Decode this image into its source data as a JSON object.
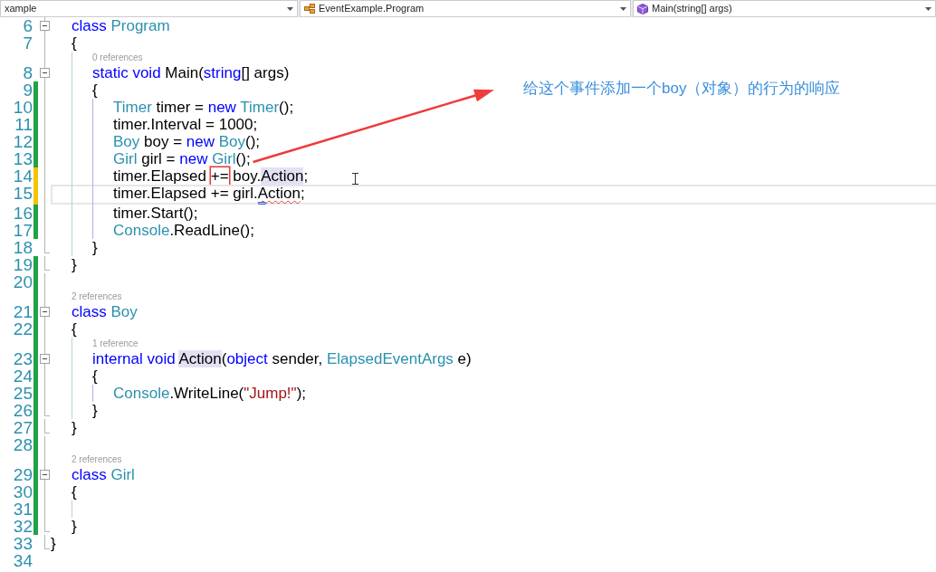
{
  "nav_bar": {
    "dropdowns": [
      {
        "label": "xample"
      },
      {
        "label": "EventExample.Program"
      },
      {
        "label": "Main(string[] args)"
      }
    ]
  },
  "code": [
    {
      "children": [
        {
          "number": "6",
          "expanded": true,
          "tokens": [
            {
              "text": "class",
              "kind": "keyword"
            },
            {
              "text": " Program",
              "kind": "type"
            }
          ]
        },
        {
          "number": "7",
          "tokens": [
            {
              "text": "{",
              "kind": "plain"
            }
          ],
          "children": [
            {
              "number": "8",
              "expanded": true,
              "lens": "0 references",
              "tokens": [
                {
                  "text": "static",
                  "kind": "keyword"
                },
                {
                  "text": " void",
                  "kind": "keyword"
                },
                {
                  "text": " Main(",
                  "kind": "plain"
                },
                {
                  "text": "string",
                  "kind": "keyword"
                },
                {
                  "text": "[] args)",
                  "kind": "plain"
                }
              ]
            },
            {
              "number": "9",
              "saved": true,
              "tokens": [
                {
                  "text": "{",
                  "kind": "plain"
                }
              ],
              "children": [
                {
                  "number": "10",
                  "saved": true,
                  "tokens": [
                    {
                      "text": "Timer",
                      "kind": "type"
                    },
                    {
                      "text": " timer = ",
                      "kind": "plain"
                    },
                    {
                      "text": "new",
                      "kind": "keyword"
                    },
                    {
                      "text": " Timer",
                      "kind": "type"
                    },
                    {
                      "text": "();",
                      "kind": "plain"
                    }
                  ]
                },
                {
                  "number": "11",
                  "saved": true,
                  "tokens": [
                    {
                      "text": "timer.Interval = 1000;",
                      "kind": "plain"
                    }
                  ]
                },
                {
                  "number": "12",
                  "saved": true,
                  "tokens": [
                    {
                      "text": "Boy",
                      "kind": "type"
                    },
                    {
                      "text": " boy = ",
                      "kind": "plain"
                    },
                    {
                      "text": "new",
                      "kind": "keyword"
                    },
                    {
                      "text": " Boy",
                      "kind": "type"
                    },
                    {
                      "text": "();",
                      "kind": "plain"
                    }
                  ]
                },
                {
                  "number": "13",
                  "saved": true,
                  "tokens": [
                    {
                      "text": "Girl",
                      "kind": "type"
                    },
                    {
                      "text": " girl = ",
                      "kind": "plain"
                    },
                    {
                      "text": "new",
                      "kind": "keyword"
                    },
                    {
                      "text": " Girl",
                      "kind": "type"
                    },
                    {
                      "text": "();",
                      "kind": "plain"
                    }
                  ]
                },
                {
                  "number": "14",
                  "saved": false,
                  "tokens": [
                    {
                      "text": "timer.Elapsed ",
                      "kind": "plain"
                    },
                    {
                      "text": "+=",
                      "kind": "plain",
                      "boxed": true
                    },
                    {
                      "text": " boy.",
                      "kind": "plain"
                    },
                    {
                      "text": "Action",
                      "kind": "plain",
                      "highlighted": true
                    },
                    {
                      "text": ";",
                      "kind": "plain"
                    }
                  ]
                },
                {
                  "number": "15",
                  "saved": false,
                  "current": true,
                  "tokens": [
                    {
                      "text": "timer.Elapsed += girl.",
                      "kind": "plain"
                    },
                    {
                      "text": "Action",
                      "kind": "plain",
                      "error": true
                    },
                    {
                      "text": ";",
                      "kind": "plain"
                    }
                  ]
                },
                {
                  "number": "16",
                  "saved": true,
                  "tokens": [
                    {
                      "text": "timer.Start();",
                      "kind": "plain"
                    }
                  ]
                },
                {
                  "number": "17",
                  "saved": true,
                  "tokens": [
                    {
                      "text": "Console",
                      "kind": "type"
                    },
                    {
                      "text": ".ReadLine();",
                      "kind": "plain"
                    }
                  ]
                }
              ]
            },
            {
              "number": "18",
              "tokens": [
                {
                  "text": "}",
                  "kind": "plain"
                }
              ]
            }
          ]
        },
        {
          "number": "19",
          "saved": true,
          "tokens": [
            {
              "text": "}",
              "kind": "plain"
            }
          ]
        },
        {
          "number": "20",
          "saved": true
        },
        {
          "number": "21",
          "saved": true,
          "expanded": true,
          "lens": "2 references",
          "tokens": [
            {
              "text": "class",
              "kind": "keyword"
            },
            {
              "text": " Boy",
              "kind": "type"
            }
          ]
        },
        {
          "number": "22",
          "saved": true,
          "tokens": [
            {
              "text": "{",
              "kind": "plain"
            }
          ],
          "children": [
            {
              "number": "23",
              "saved": true,
              "expanded": true,
              "lens": "1 reference",
              "tokens": [
                {
                  "text": "internal",
                  "kind": "keyword"
                },
                {
                  "text": " void ",
                  "kind": "keyword"
                },
                {
                  "text": "Action",
                  "kind": "plain",
                  "highlighted": true
                },
                {
                  "text": "(",
                  "kind": "plain"
                },
                {
                  "text": "object",
                  "kind": "keyword"
                },
                {
                  "text": " sender, ",
                  "kind": "plain"
                },
                {
                  "text": "ElapsedEventArgs",
                  "kind": "type"
                },
                {
                  "text": " e)",
                  "kind": "plain"
                }
              ]
            },
            {
              "number": "24",
              "saved": true,
              "tokens": [
                {
                  "text": "{",
                  "kind": "plain"
                }
              ],
              "children": [
                {
                  "number": "25",
                  "saved": true,
                  "tokens": [
                    {
                      "text": "Console",
                      "kind": "type"
                    },
                    {
                      "text": ".WriteLine(",
                      "kind": "plain"
                    },
                    {
                      "text": "\"Jump!\"",
                      "kind": "string"
                    },
                    {
                      "text": ");",
                      "kind": "plain"
                    }
                  ]
                }
              ]
            },
            {
              "number": "26",
              "saved": true,
              "tokens": [
                {
                  "text": "}",
                  "kind": "plain"
                }
              ]
            }
          ]
        },
        {
          "number": "27",
          "saved": true,
          "tokens": [
            {
              "text": "}",
              "kind": "plain"
            }
          ]
        },
        {
          "number": "28",
          "saved": true
        },
        {
          "number": "29",
          "saved": true,
          "expanded": true,
          "lens": "2 references",
          "tokens": [
            {
              "text": "class",
              "kind": "keyword"
            },
            {
              "text": " Girl",
              "kind": "type"
            }
          ]
        },
        {
          "number": "30",
          "saved": true,
          "tokens": [
            {
              "text": "{",
              "kind": "plain"
            }
          ],
          "children": [
            {
              "number": "31",
              "saved": true
            }
          ]
        },
        {
          "number": "32",
          "saved": true,
          "tokens": [
            {
              "text": "}",
              "kind": "plain"
            }
          ]
        }
      ]
    },
    {
      "number": "33",
      "tokens": [
        {
          "text": "}",
          "kind": "plain"
        }
      ]
    },
    {
      "number": "34"
    }
  ],
  "annotation": {
    "text": "给这个事件添加一个boy（对象）的行为的响应"
  }
}
